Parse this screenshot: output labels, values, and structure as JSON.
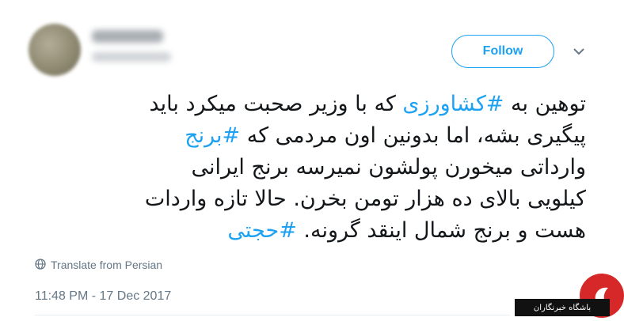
{
  "follow_label": "Follow",
  "tweet": {
    "lines": [
      [
        {
          "text": "توهین به "
        },
        {
          "text": "#کشاورزی",
          "hashtag": true
        },
        {
          "text": " که با وزیر صحبت میکرد باید"
        }
      ],
      [
        {
          "text": "پیگیری بشه، اما بدونین اون مردمی که "
        },
        {
          "text": "#برنج",
          "hashtag": true
        }
      ],
      [
        {
          "text": "وارداتی میخورن پولشون نمیرسه برنج ایرانی"
        }
      ],
      [
        {
          "text": "کیلویی بالای ده هزار تومن بخرن. حالا تازه واردات"
        }
      ],
      [
        {
          "text": "هست و برنج شمال اینقد گرونه. "
        },
        {
          "text": "#حجتی",
          "hashtag": true
        }
      ]
    ]
  },
  "translate_label": "Translate from Persian",
  "timestamp": "11:48 PM - 17 Dec 2017",
  "watermark": {
    "text": "باشگاه خبرنگاران"
  },
  "colors": {
    "accent": "#1da1f2",
    "text": "#14171a",
    "muted": "#657786"
  },
  "icons": {
    "translate": "globe-icon",
    "menu": "chevron-down-icon",
    "logo": "brand-logo-icon"
  }
}
